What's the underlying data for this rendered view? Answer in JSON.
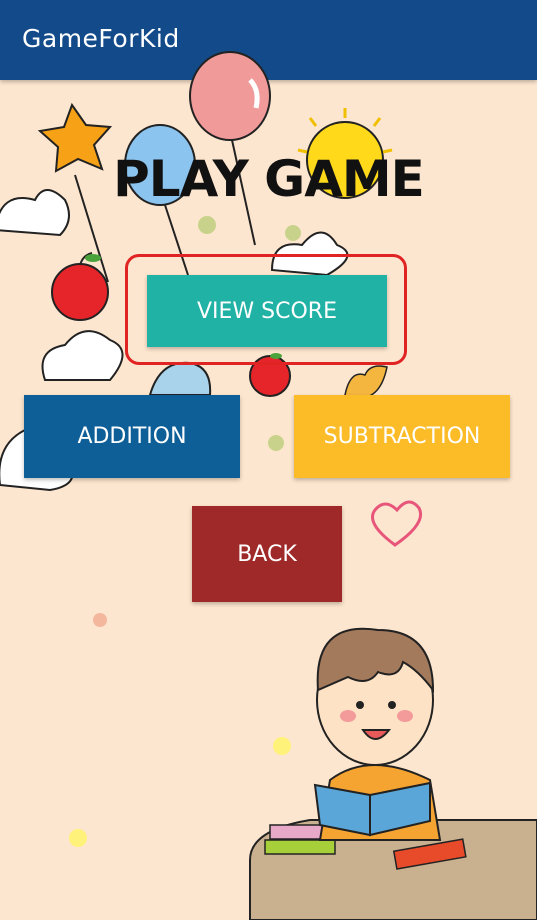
{
  "appbar": {
    "title": "GameForKid"
  },
  "main": {
    "headline": "PLAY GAME",
    "view_score_label": "VIEW SCORE",
    "addition_label": "ADDITION",
    "subtraction_label": "SUBTRACTION",
    "back_label": "BACK"
  },
  "colors": {
    "appbar": "#134b8a",
    "background": "#fde6cf",
    "view_score": "#21b2a6",
    "addition": "#0e5f97",
    "subtraction": "#fbbc27",
    "back": "#9f2929",
    "highlight": "#e02424"
  }
}
